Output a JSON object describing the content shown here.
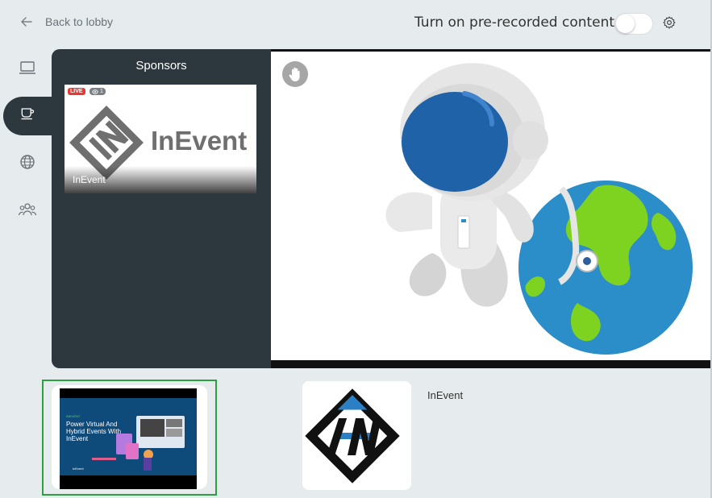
{
  "header": {
    "back_label": "Back to lobby",
    "toggle_label": "Turn on pre-recorded content",
    "toggle_on": false
  },
  "rail": {
    "items": [
      "laptop-icon",
      "coffee-icon",
      "globe-icon",
      "people-icon"
    ],
    "active_index": 1
  },
  "panel": {
    "title": "Sponsors",
    "card": {
      "live_label": "LIVE",
      "viewer_count": "1",
      "logo_text": "InEvent",
      "name": "InEvent"
    }
  },
  "stage": {
    "hand_icon": "raise-hand-icon"
  },
  "bottom": {
    "thumb": {
      "tag": "INEVENT",
      "headline": "Power Virtual And Hybrid Events With InEvent",
      "brand": "InEvent"
    },
    "sponsor_name": "InEvent"
  },
  "colors": {
    "panel_bg": "#2d373e",
    "page_bg": "#e6ebee",
    "live_red": "#e53935",
    "selected_green": "#2ea043"
  }
}
